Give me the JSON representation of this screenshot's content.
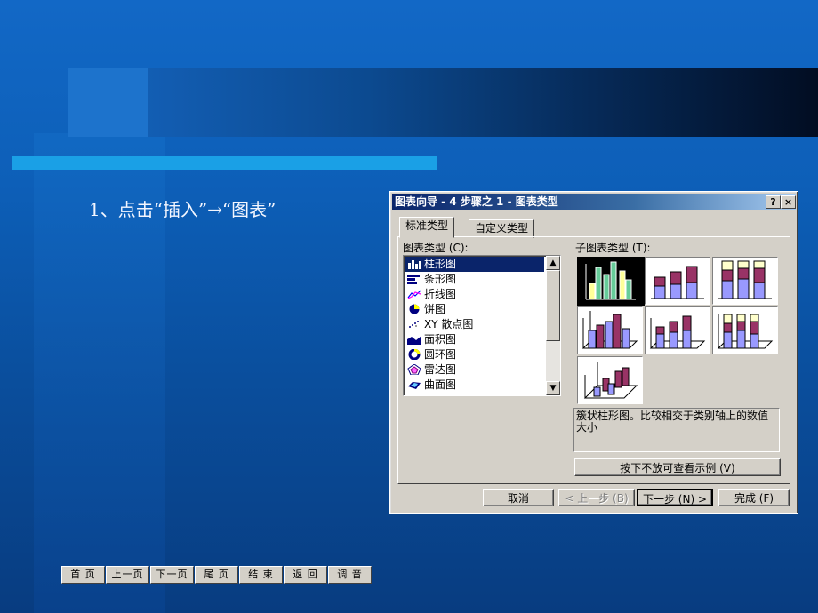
{
  "slide": {
    "step_text": "1、点击“插入”→“图表”"
  },
  "dialog": {
    "title": "图表向导 - 4 步骤之 1 - 图表类型",
    "help_btn": "?",
    "close_btn": "×",
    "tabs": [
      {
        "label": "标准类型",
        "active": true
      },
      {
        "label": "自定义类型",
        "active": false
      }
    ],
    "chart_type_label": "图表类型 (C):",
    "subtype_label": "子图表类型 (T):",
    "chart_types": [
      {
        "label": "柱形图",
        "icon": "column-chart-icon",
        "selected": true
      },
      {
        "label": "条形图",
        "icon": "bar-chart-icon",
        "selected": false
      },
      {
        "label": "折线图",
        "icon": "line-chart-icon",
        "selected": false
      },
      {
        "label": "饼图",
        "icon": "pie-chart-icon",
        "selected": false
      },
      {
        "label": "XY 散点图",
        "icon": "scatter-chart-icon",
        "selected": false
      },
      {
        "label": "面积图",
        "icon": "area-chart-icon",
        "selected": false
      },
      {
        "label": "圆环图",
        "icon": "doughnut-chart-icon",
        "selected": false
      },
      {
        "label": "雷达图",
        "icon": "radar-chart-icon",
        "selected": false
      },
      {
        "label": "曲面图",
        "icon": "surface-chart-icon",
        "selected": false
      }
    ],
    "description": "簇状柱形图。比较相交于类别轴上的数值大小",
    "preview_button": "按下不放可查看示例 (V)",
    "buttons": {
      "cancel": "取消",
      "back": "< 上一步 (B)",
      "next": "下一步 (N) >",
      "finish": "完成 (F)"
    },
    "colors": {
      "title_start": "#0a246a",
      "title_end": "#a6caf0",
      "face": "#d4d0c8",
      "selection": "#0a246a"
    }
  },
  "nav": [
    "首 页",
    "上一页",
    "下一页",
    "尾 页",
    "结 束",
    "返 回",
    "调 音"
  ]
}
